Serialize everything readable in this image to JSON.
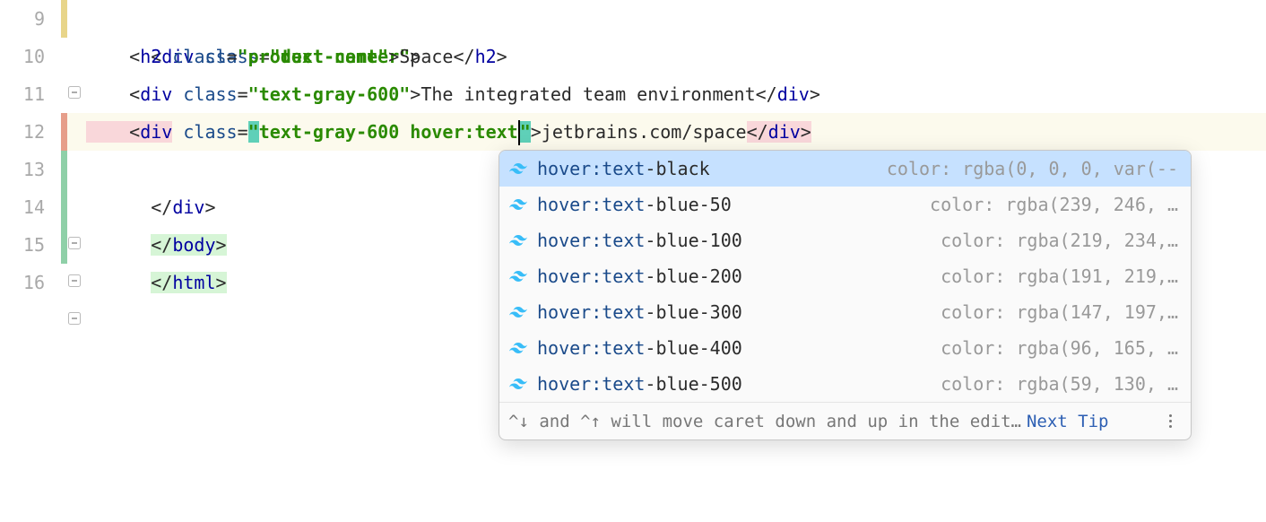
{
  "gutter": {
    "lines": [
      "9",
      "10",
      "11",
      "12",
      "13",
      "14",
      "15",
      "16"
    ]
  },
  "code": {
    "l9": {
      "indent1": "",
      "open": "<",
      "tag": "div",
      "sp": " ",
      "attr": "class",
      "eq": "=",
      "q1": "\"",
      "val": "text-center",
      "q2": "\"",
      "close": ">"
    },
    "l10": {
      "indent": "    ",
      "open": "<",
      "tag": "h2",
      "sp": " ",
      "attr": "class",
      "eq": "=",
      "q1": "\"",
      "val": "product-name",
      "q2": "\"",
      "close": ">",
      "text": "Space",
      "copen": "</",
      "ctag": "h2",
      "cclose": ">"
    },
    "l11": {
      "indent": "    ",
      "open": "<",
      "tag": "div",
      "sp": " ",
      "attr": "class",
      "eq": "=",
      "q1": "\"",
      "val": "text-gray-600",
      "q2": "\"",
      "close": ">",
      "text": "The integrated team environment",
      "copen": "</",
      "ctag": "div",
      "cclose": ">"
    },
    "l12": {
      "indent": "    ",
      "open": "<",
      "tag": "div",
      "sp": " ",
      "attr": "class",
      "eq": "=",
      "q1": "\"",
      "val1": "text-gray-600 ",
      "val2": "hover:text",
      "q2": "\"",
      "close": ">",
      "text": "jetbrains.com/space",
      "copen": "</",
      "ctag": "div",
      "cclose": ">"
    },
    "l13": {
      "open": "</",
      "tag": "div",
      "close": ">"
    },
    "l14": {
      "open": "</",
      "tag": "body",
      "close": ">"
    },
    "l15": {
      "open": "</",
      "tag": "html",
      "close": ">"
    }
  },
  "popup": {
    "items": [
      {
        "prefix": "hover:text",
        "suffix": "-black",
        "info": "color: rgba(0, 0, 0, var(--"
      },
      {
        "prefix": "hover:text",
        "suffix": "-blue-50",
        "info": "color: rgba(239, 246, …"
      },
      {
        "prefix": "hover:text",
        "suffix": "-blue-100",
        "info": "color: rgba(219, 234,…"
      },
      {
        "prefix": "hover:text",
        "suffix": "-blue-200",
        "info": "color: rgba(191, 219,…"
      },
      {
        "prefix": "hover:text",
        "suffix": "-blue-300",
        "info": "color: rgba(147, 197,…"
      },
      {
        "prefix": "hover:text",
        "suffix": "-blue-400",
        "info": "color: rgba(96, 165, …"
      },
      {
        "prefix": "hover:text",
        "suffix": "-blue-500",
        "info": "color: rgba(59, 130, …"
      }
    ],
    "hint": "^↓ and ^↑ will move caret down and up in the edit…",
    "link": "Next Tip"
  }
}
